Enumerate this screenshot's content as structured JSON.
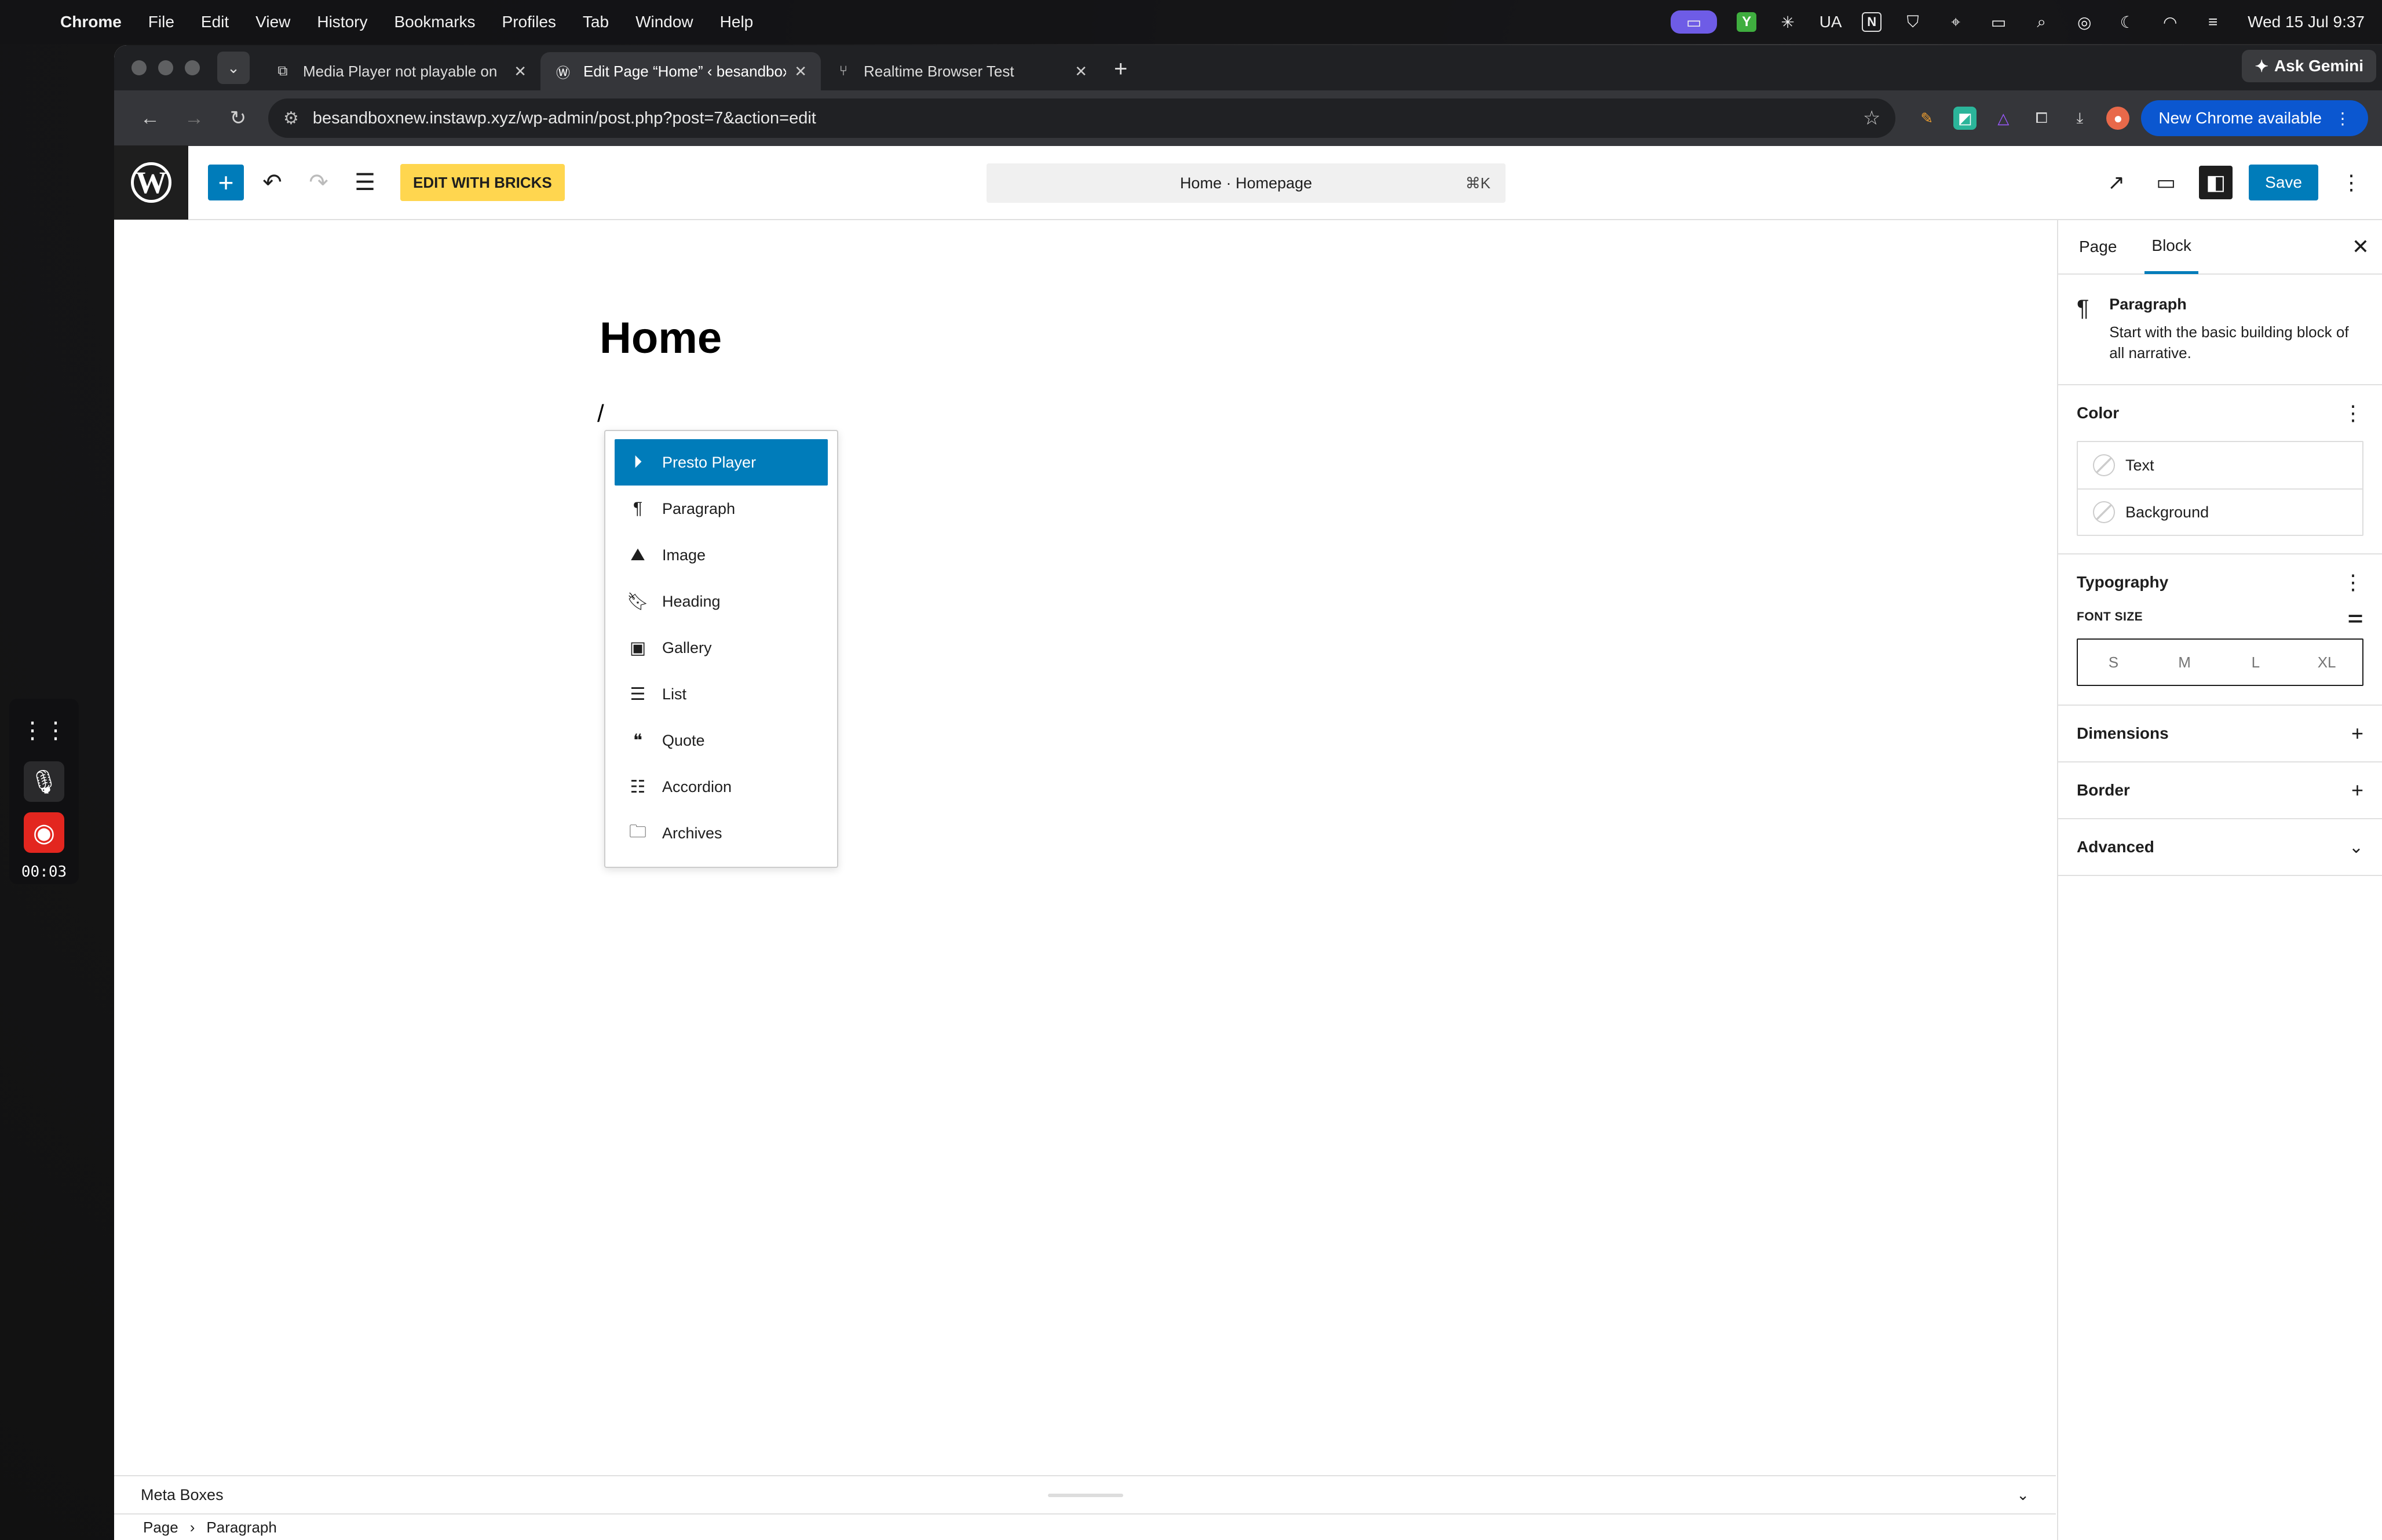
{
  "menubar": {
    "app": "Chrome",
    "items": [
      "File",
      "Edit",
      "View",
      "History",
      "Bookmarks",
      "Profiles",
      "Tab",
      "Window",
      "Help"
    ],
    "status_ua": "UA",
    "status_n": "N",
    "clock": "Wed 15 Jul  9:37"
  },
  "browser": {
    "tabs": [
      {
        "title": "Media Player not playable on"
      },
      {
        "title": "Edit Page “Home” ‹ besandbox"
      },
      {
        "title": "Realtime Browser Test"
      }
    ],
    "ask_gemini": "Ask Gemini",
    "url": "besandboxnew.instawp.xyz/wp-admin/post.php?post=7&action=edit",
    "new_chrome": "New Chrome available"
  },
  "wp": {
    "edit_with_bricks": "EDIT WITH BRICKS",
    "command_title": "Home · Homepage",
    "command_shortcut": "⌘K",
    "save": "Save"
  },
  "canvas": {
    "title": "Home",
    "slash": "/"
  },
  "inserter": {
    "items": [
      {
        "label": "Presto Player",
        "icon": "play-circle-icon"
      },
      {
        "label": "Paragraph",
        "icon": "paragraph-icon"
      },
      {
        "label": "Image",
        "icon": "image-icon"
      },
      {
        "label": "Heading",
        "icon": "bookmark-icon"
      },
      {
        "label": "Gallery",
        "icon": "gallery-icon"
      },
      {
        "label": "List",
        "icon": "list-icon"
      },
      {
        "label": "Quote",
        "icon": "quote-icon"
      },
      {
        "label": "Accordion",
        "icon": "accordion-icon"
      },
      {
        "label": "Archives",
        "icon": "folder-icon"
      }
    ]
  },
  "footer": {
    "meta_boxes": "Meta Boxes",
    "crumb_page": "Page",
    "crumb_sep": "›",
    "crumb_block": "Paragraph"
  },
  "sidebar": {
    "tab_page": "Page",
    "tab_block": "Block",
    "block_title": "Paragraph",
    "block_desc": "Start with the basic building block of all narrative.",
    "color_title": "Color",
    "color_text": "Text",
    "color_background": "Background",
    "typography_title": "Typography",
    "font_size_label": "FONT SIZE",
    "sizes": [
      "S",
      "M",
      "L",
      "XL"
    ],
    "dimensions": "Dimensions",
    "border": "Border",
    "advanced": "Advanced"
  },
  "recorder": {
    "time": "00:03"
  },
  "colors": {
    "wp_blue": "#007cba",
    "bricks_yellow": "#ffd64f",
    "record_red": "#e3261f"
  }
}
